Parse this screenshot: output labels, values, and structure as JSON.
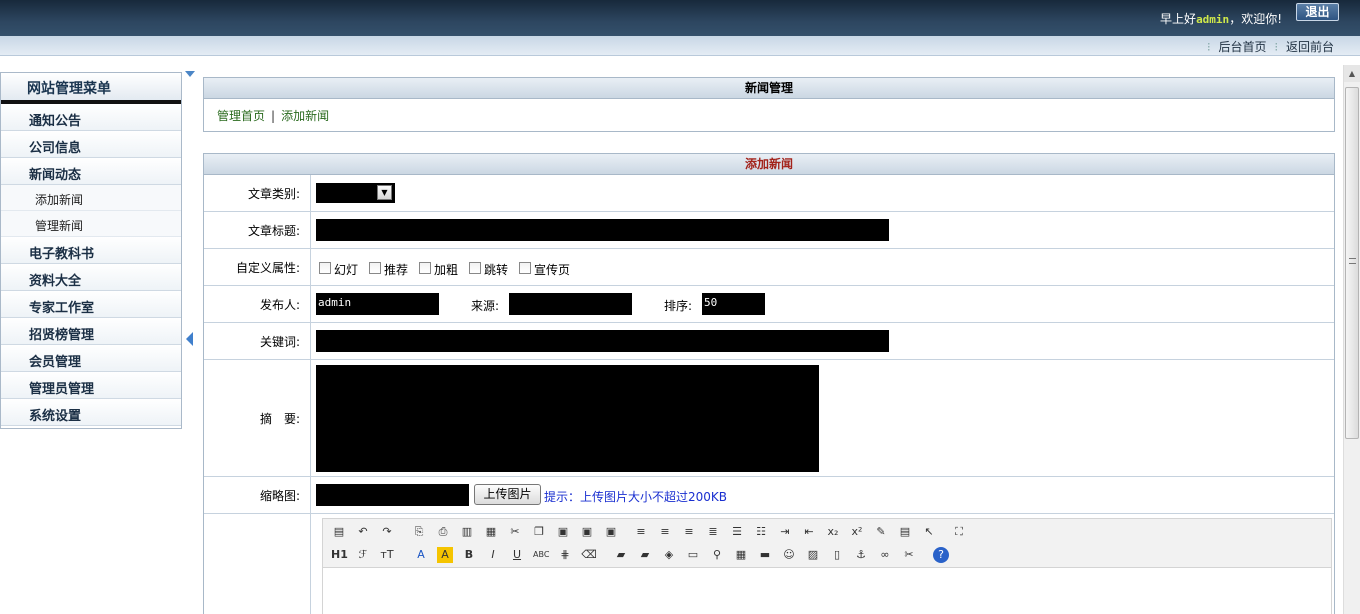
{
  "header": {
    "greeting_prefix": "早上好",
    "username": "admin",
    "greeting_suffix": "，欢迎你!",
    "logout_label": "退出",
    "links": [
      "后台首页",
      "返回前台"
    ]
  },
  "menu": {
    "title": "网站管理菜单",
    "items": [
      {
        "label": "通知公告"
      },
      {
        "label": "公司信息"
      },
      {
        "label": "新闻动态"
      },
      {
        "label": "添加新闻",
        "sub": true
      },
      {
        "label": "管理新闻",
        "sub": true
      },
      {
        "label": "电子教科书"
      },
      {
        "label": "资料大全"
      },
      {
        "label": "专家工作室"
      },
      {
        "label": "招贤榜管理"
      },
      {
        "label": "会员管理"
      },
      {
        "label": "管理员管理"
      },
      {
        "label": "系统设置"
      }
    ]
  },
  "news_panel": {
    "title": "新闻管理",
    "breadcrumb_home": "管理首页",
    "breadcrumb_sep": "|",
    "breadcrumb_current": "添加新闻"
  },
  "form": {
    "title": "添加新闻",
    "category_label": "文章类别:",
    "title_label": "文章标题:",
    "attrs_label": "自定义属性:",
    "attrs": [
      "幻灯",
      "推荐",
      "加粗",
      "跳转",
      "宣传页"
    ],
    "author_label": "发布人:",
    "author_value": "admin",
    "source_label": "来源:",
    "order_label": "排序:",
    "order_value": "50",
    "keywords_label": "关键词:",
    "summary_label": "摘　要:",
    "thumb_label": "缩略图:",
    "upload_button": "上传图片",
    "upload_hint": "提示：上传图片大小不超过200KB"
  },
  "editor": {
    "toolbar_row1": [
      "paste-icon",
      "undo-icon",
      "redo-icon",
      "preview-icon",
      "print-icon",
      "template-icon",
      "code-icon",
      "cut-icon",
      "copy-icon",
      "paste-plain-icon",
      "paste-text-icon",
      "paste-word-icon",
      "align-left-icon",
      "align-center-icon",
      "align-right-icon",
      "justify-icon",
      "ordered-list-icon",
      "unordered-list-icon",
      "indent-icon",
      "outdent-icon",
      "subscript-icon",
      "superscript-icon",
      "clear-format-icon",
      "select-all-icon",
      "cursor-icon",
      "fullscreen-icon"
    ],
    "toolbar_row2": [
      "heading-icon",
      "font-family-icon",
      "font-size-icon",
      "font-color-icon",
      "highlight-icon",
      "bold-icon",
      "italic-icon",
      "underline-icon",
      "strikethrough-icon",
      "line-height-icon",
      "remove-format-icon",
      "image-icon",
      "multi-image-icon",
      "flash-icon",
      "media-icon",
      "attachment-icon",
      "table-icon",
      "horizontal-line-icon",
      "emoticon-icon",
      "map-icon",
      "pagebreak-icon",
      "anchor-icon",
      "link-icon",
      "unlink-icon",
      "help-icon"
    ],
    "row2_text": [
      "H1",
      "ℱ",
      "тT",
      "A",
      "A",
      "B",
      "I",
      "U",
      "ABC"
    ]
  }
}
